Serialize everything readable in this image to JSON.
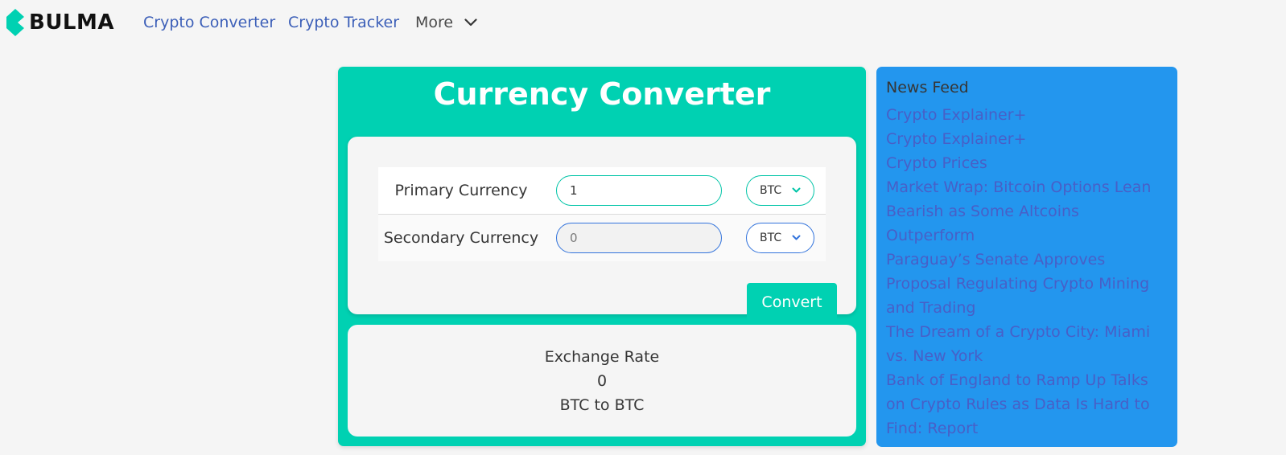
{
  "navbar": {
    "brand": "BULMA",
    "links": [
      {
        "label": "Crypto Converter"
      },
      {
        "label": "Crypto Tracker"
      }
    ],
    "more_label": "More"
  },
  "converter": {
    "title": "Currency Converter",
    "primary": {
      "label": "Primary Currency",
      "amount": "1",
      "currency": "BTC"
    },
    "secondary": {
      "label": "Secondary Currency",
      "amount": "0",
      "currency": "BTC"
    },
    "convert_label": "Convert",
    "exchange": {
      "heading": "Exchange Rate",
      "rate": "0",
      "pair": "BTC to BTC"
    }
  },
  "news": {
    "title": "News Feed",
    "items": [
      "Crypto Explainer+",
      "Crypto Explainer+",
      "Crypto Prices",
      "Market Wrap: Bitcoin Options Lean Bearish as Some Altcoins Outperform",
      "Paraguay’s Senate Approves Proposal Regulating Crypto Mining and Trading",
      "The Dream of a Crypto City: Miami vs. New York",
      "Bank of England to Ramp Up Talks on Crypto Rules as Data Is Hard to Find: Report"
    ]
  },
  "colors": {
    "primary": "#00d1b2",
    "info": "#2396ee",
    "link": "#485fc7",
    "background": "#f5f5f5"
  }
}
